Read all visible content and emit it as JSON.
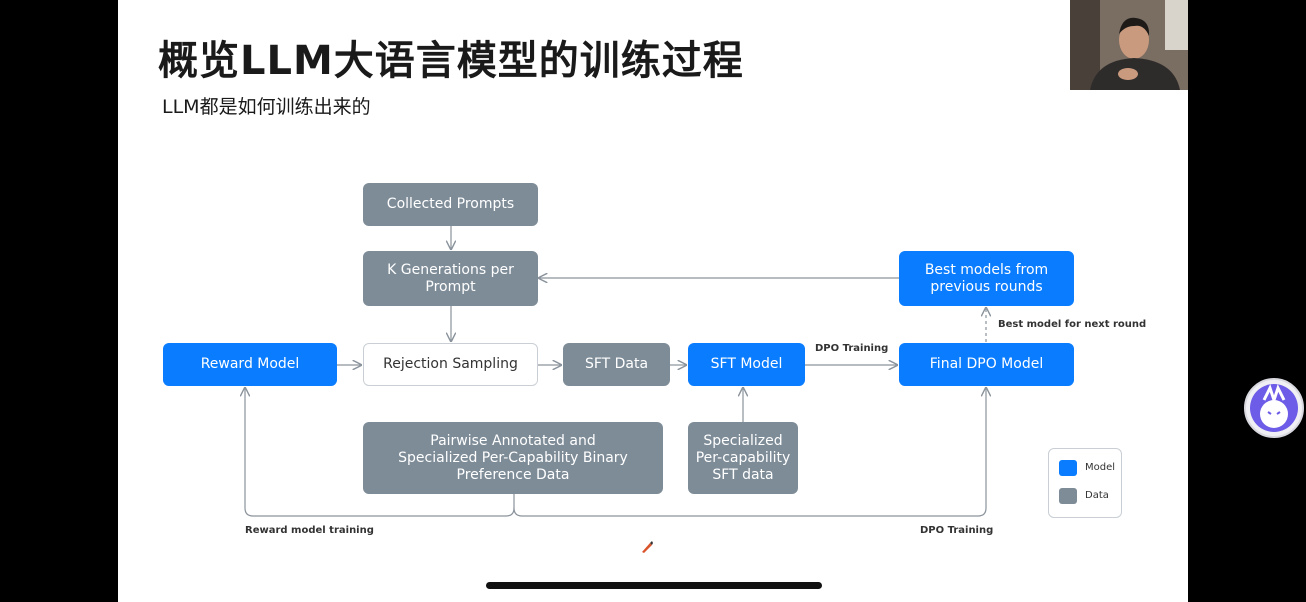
{
  "slide": {
    "title": "概览LLM大语言模型的训练过程",
    "subtitle": "LLM都是如何训练出来的"
  },
  "diagram": {
    "nodes": {
      "collected_prompts": "Collected Prompts",
      "k_generations": "K Generations per Prompt",
      "best_models": "Best models from previous rounds",
      "reward_model": "Reward Model",
      "rejection_sampling": "Rejection Sampling",
      "sft_data": "SFT Data",
      "sft_model": "SFT Model",
      "final_dpo": "Final DPO Model",
      "pairwise_data": "Pairwise Annotated and Specialized Per-Capability Binary Preference Data",
      "specialized_sft": "Specialized Per-capability SFT data"
    },
    "edge_labels": {
      "dpo_training_top": "DPO Training",
      "best_model_next": "Best model for next round",
      "reward_model_training": "Reward model training",
      "dpo_training_bottom": "DPO Training"
    },
    "legend": {
      "model": "Model",
      "data": "Data"
    },
    "colors": {
      "model": "#0a7cff",
      "data": "#7e8c98"
    }
  }
}
